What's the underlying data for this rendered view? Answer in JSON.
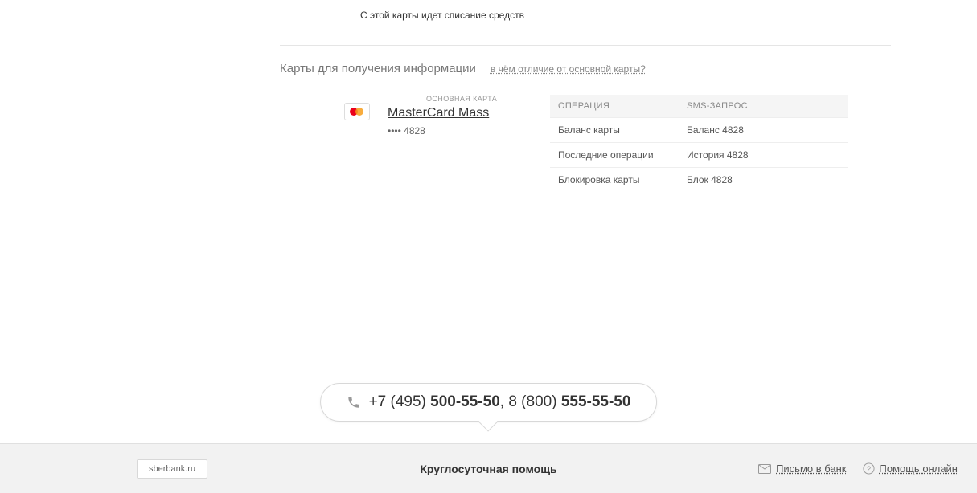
{
  "notice": "С этой карты идет списание средств",
  "section": {
    "title": "Карты для получения информации",
    "diff_link": "в чём отличие от основной карты?"
  },
  "card": {
    "primary_label": "ОСНОВНАЯ КАРТА",
    "name": "MasterCard Mass",
    "masked": "•••• 4828"
  },
  "table": {
    "head_op": "ОПЕРАЦИЯ",
    "head_sms": "SMS-ЗАПРОС",
    "rows": [
      {
        "op": "Баланс карты",
        "sms": "Баланс 4828"
      },
      {
        "op": "Последние операции",
        "sms": "История 4828"
      },
      {
        "op": "Блокировка карты",
        "sms": "Блок 4828"
      }
    ]
  },
  "phones": {
    "p1_prefix": "+7 (495) ",
    "p1_bold": "500-55-50",
    "sep": ", ",
    "p2_prefix": "8 (800) ",
    "p2_bold": "555-55-50"
  },
  "footer": {
    "site": "sberbank.ru",
    "help_title": "Круглосуточная помощь",
    "mail_link": "Письмо в банк",
    "online_link": "Помощь онлайн"
  }
}
